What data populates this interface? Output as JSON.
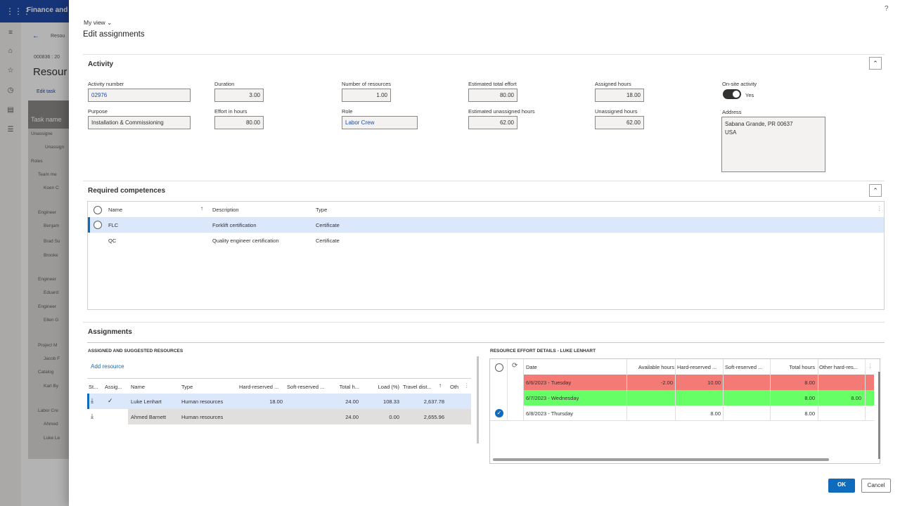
{
  "app": {
    "name": "Finance and"
  },
  "background": {
    "back_link": "Resou",
    "record_id": "000836 : 20",
    "page_title": "Resour",
    "edit_tasks": "Edit task",
    "grid_header": "Task name",
    "rows": [
      "Unassigne",
      "Unassign",
      "Roles",
      "Team me",
      "Koen C",
      "Engineer",
      "Benjam",
      "Brad Su",
      "Brooke",
      "Engineer",
      "Eduard",
      "Engineer",
      "Ellen G",
      "Project M",
      "Jacob F",
      "Catalog",
      "Karl By",
      "Labor Cre",
      "Ahmed",
      "Luke Le"
    ]
  },
  "dialog": {
    "view_selector": "My view",
    "title": "Edit assignments",
    "help_icon": "?"
  },
  "activity": {
    "section_title": "Activity",
    "activity_number_label": "Activity number",
    "activity_number": "02976",
    "duration_label": "Duration",
    "duration": "3.00",
    "num_resources_label": "Number of resources",
    "num_resources": "1.00",
    "est_total_effort_label": "Estimated total effort",
    "est_total_effort": "80.00",
    "assigned_hours_label": "Assigned hours",
    "assigned_hours": "18.00",
    "onsite_label": "On-site activity",
    "onsite_value": "Yes",
    "purpose_label": "Purpose",
    "purpose": "Installation & Commissioning",
    "effort_hours_label": "Effort in hours",
    "effort_hours": "80.00",
    "role_label": "Role",
    "role": "Labor Crew",
    "est_unassigned_label": "Estimated unassigned hours",
    "est_unassigned": "62.00",
    "unassigned_label": "Unassigned hours",
    "unassigned": "62.00",
    "address_label": "Address",
    "address_line1": "Sabana Grande, PR 00637",
    "address_line2": "USA"
  },
  "competences": {
    "section_title": "Required competences",
    "columns": {
      "name": "Name",
      "description": "Description",
      "type": "Type"
    },
    "rows": [
      {
        "name": "FLC",
        "description": "Forklift certification",
        "type": "Certificate"
      },
      {
        "name": "QC",
        "description": "Quality engineer certification",
        "type": "Certificate"
      }
    ]
  },
  "assignments": {
    "section_title": "Assignments",
    "left_title": "ASSIGNED AND SUGGESTED RESOURCES",
    "add_resource": "Add resource",
    "columns": {
      "status": "St...",
      "assigned": "Assig...",
      "name": "Name",
      "type": "Type",
      "hard_reserved": "Hard-reserved ...",
      "soft_reserved": "Soft-reserved ...",
      "total_hours": "Total h...",
      "load": "Load (%)",
      "travel": "Travel dist...",
      "other": "Oth"
    },
    "rows": [
      {
        "name": "Luke Lenhart",
        "type": "Human resources",
        "hard_reserved": "18.00",
        "soft_reserved": "",
        "total_hours": "24.00",
        "load": "108.33",
        "travel": "2,637.78"
      },
      {
        "name": "Ahmed Barnett",
        "type": "Human resources",
        "hard_reserved": "",
        "soft_reserved": "",
        "total_hours": "24.00",
        "load": "0.00",
        "travel": "2,655.96"
      }
    ],
    "right_title": "RESOURCE EFFORT DETAILS - LUKE LENHART",
    "effort_columns": {
      "date": "Date",
      "available": "Available hours",
      "hard": "Hard-reserved ...",
      "soft": "Soft-reserved ...",
      "total": "Total hours",
      "other": "Other hard-res..."
    },
    "effort_rows": [
      {
        "date": "6/6/2023 - Tuesday",
        "available": "-2.00",
        "hard": "10.00",
        "soft": "",
        "total": "8.00",
        "other": "",
        "color": "#f47a76"
      },
      {
        "date": "6/7/2023 - Wednesday",
        "available": "",
        "hard": "",
        "soft": "",
        "total": "8.00",
        "other": "8.00",
        "color": "#66ff66"
      },
      {
        "date": "6/8/2023 - Thursday",
        "available": "",
        "hard": "8.00",
        "soft": "",
        "total": "8.00",
        "other": "",
        "color": "#ffffff"
      }
    ]
  },
  "footer": {
    "ok": "OK",
    "cancel": "Cancel"
  },
  "colors": {
    "brand": "#1f4aa8",
    "accent": "#0f6cbd",
    "selected_row": "#dbe7fb",
    "over_allocated": "#f47a76",
    "available": "#66ff66"
  }
}
